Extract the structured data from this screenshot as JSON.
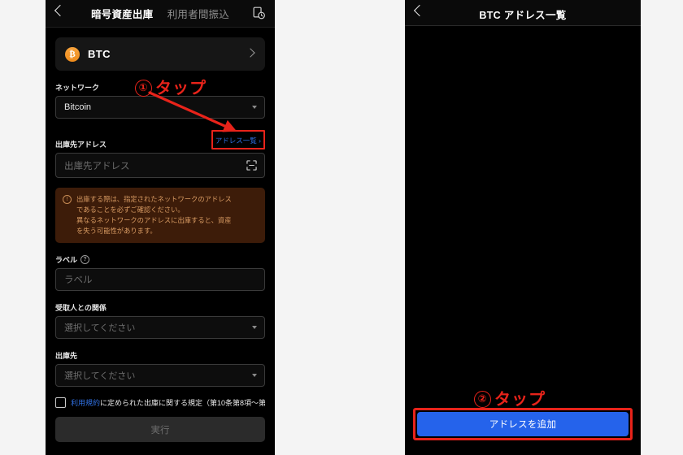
{
  "left_screen": {
    "header": {
      "back_icon": "chevron-left-icon",
      "tab_active": "暗号資産出庫",
      "tab_inactive": "利用者間振込",
      "history_icon": "history-document-icon"
    },
    "asset_card": {
      "coin_symbol": "₿",
      "name": "BTC",
      "chevron": "chevron-right-icon"
    },
    "network": {
      "label": "ネットワーク",
      "value": "Bitcoin"
    },
    "address": {
      "label": "出庫先アドレス",
      "link": "アドレス一覧 ›",
      "placeholder": "出庫先アドレス",
      "scan_icon": "qr-scan-icon"
    },
    "warning": {
      "icon": "exclamation-circle-icon",
      "line1": "出庫する際は、指定されたネットワークのアドレス",
      "line2": "であることを必ずご確認ください。",
      "line3": "異なるネットワークのアドレスに出庫すると、資産",
      "line4": "を失う可能性があります。"
    },
    "label_field": {
      "label": "ラベル",
      "help_icon": "?",
      "placeholder": "ラベル"
    },
    "relationship": {
      "label": "受取人との関係",
      "placeholder": "選択してください"
    },
    "destination": {
      "label": "出庫先",
      "placeholder": "選択してください"
    },
    "terms": {
      "link_text": "利用規約",
      "rest_text": "に定められた出庫に関する規定（第10条第8項〜第"
    },
    "execute_button": "実行"
  },
  "right_screen": {
    "header": {
      "back_icon": "chevron-left-icon",
      "title": "BTC アドレス一覧"
    },
    "add_button": "アドレスを追加"
  },
  "annotations": {
    "step1_number": "①",
    "step1_text": "タップ",
    "step2_number": "②",
    "step2_text": "タップ"
  },
  "colors": {
    "annotation_red": "#e8231a",
    "link_blue": "#2f6fe0",
    "primary_blue": "#2563eb",
    "warning_bg": "#3d1c09",
    "warning_text": "#d79a62",
    "btc_orange": "#ef8c1c"
  }
}
